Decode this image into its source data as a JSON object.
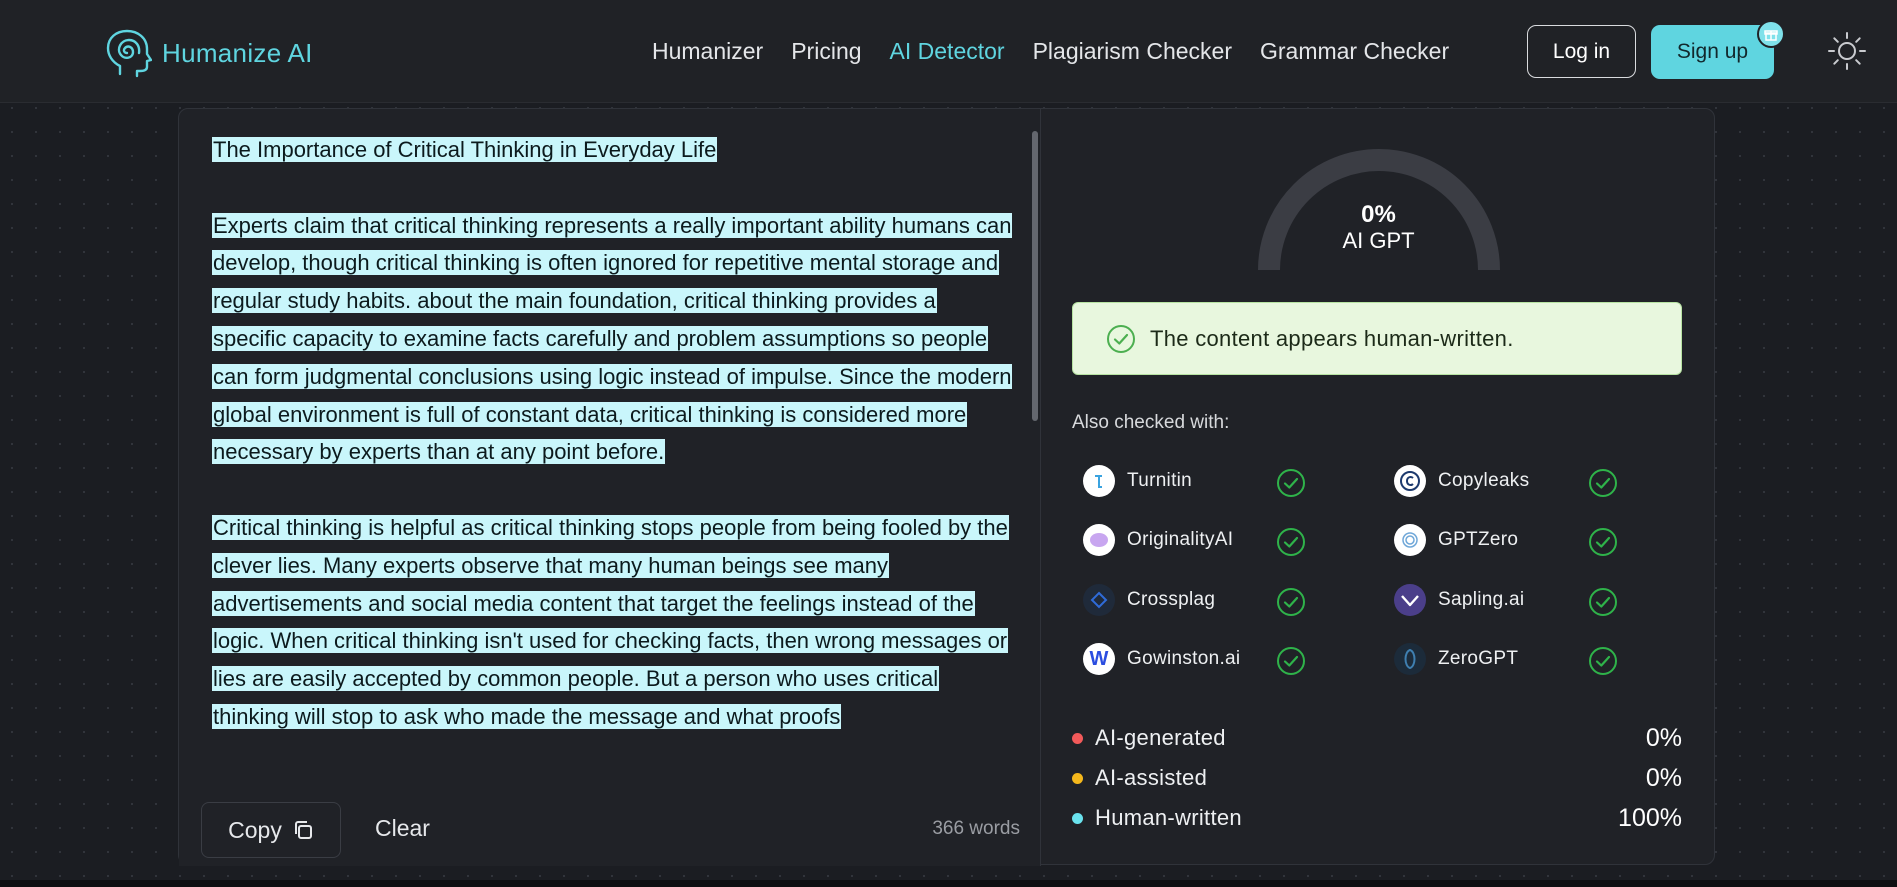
{
  "nav": {
    "brand": "Humanize AI",
    "links": [
      "Humanizer",
      "Pricing",
      "AI Detector",
      "Plagiarism Checker",
      "Grammar Checker"
    ],
    "active_link": "AI Detector",
    "login": "Log in",
    "signup": "Sign up",
    "accent_color": "#5fd5e0"
  },
  "editor": {
    "paragraphs": [
      "The Importance of Critical Thinking in Everyday Life",
      "Experts claim that critical thinking represents a really important ability humans can develop, though critical thinking is often ignored for repetitive mental storage and regular study habits. about the main foundation, critical thinking provides a specific capacity to examine facts carefully and problem assumptions so people can form judgmental conclusions using logic instead of impulse. Since the modern global environment is full of constant data, critical thinking is considered more necessary by experts than at any point before.",
      "Critical thinking is helpful as critical thinking stops people from being fooled by the clever lies. Many experts observe that many human beings see many advertisements and social media content that target the feelings instead of the logic. When critical thinking isn't used for checking facts, then wrong messages or lies are easily accepted by common people. But a person who uses critical thinking will stop to ask who made the message and what proofs"
    ],
    "copy_label": "Copy",
    "clear_label": "Clear",
    "word_count": "366 words",
    "highlight_color": "#c9f6fb"
  },
  "results": {
    "gauge_percent": "0%",
    "gauge_label": "AI GPT",
    "gauge_value": 0,
    "verdict": "The content appears human-written.",
    "also_checked_label": "Also checked with:",
    "detectors": [
      {
        "name": "Turnitin",
        "icon": "turnitin-logo",
        "passed": true
      },
      {
        "name": "Copyleaks",
        "icon": "copyleaks-logo",
        "passed": true
      },
      {
        "name": "OriginalityAI",
        "icon": "originality-logo",
        "passed": true
      },
      {
        "name": "GPTZero",
        "icon": "gptzero-logo",
        "passed": true
      },
      {
        "name": "Crossplag",
        "icon": "crossplag-logo",
        "passed": true
      },
      {
        "name": "Sapling.ai",
        "icon": "sapling-logo",
        "passed": true
      },
      {
        "name": "Gowinston.ai",
        "icon": "winston-logo",
        "passed": true
      },
      {
        "name": "ZeroGPT",
        "icon": "zerogpt-logo",
        "passed": true
      }
    ],
    "breakdown": [
      {
        "label": "AI-generated",
        "value": "0%",
        "color": "#f25a5a"
      },
      {
        "label": "AI-assisted",
        "value": "0%",
        "color": "#f5b81c"
      },
      {
        "label": "Human-written",
        "value": "100%",
        "color": "#6ae3ee"
      }
    ]
  }
}
